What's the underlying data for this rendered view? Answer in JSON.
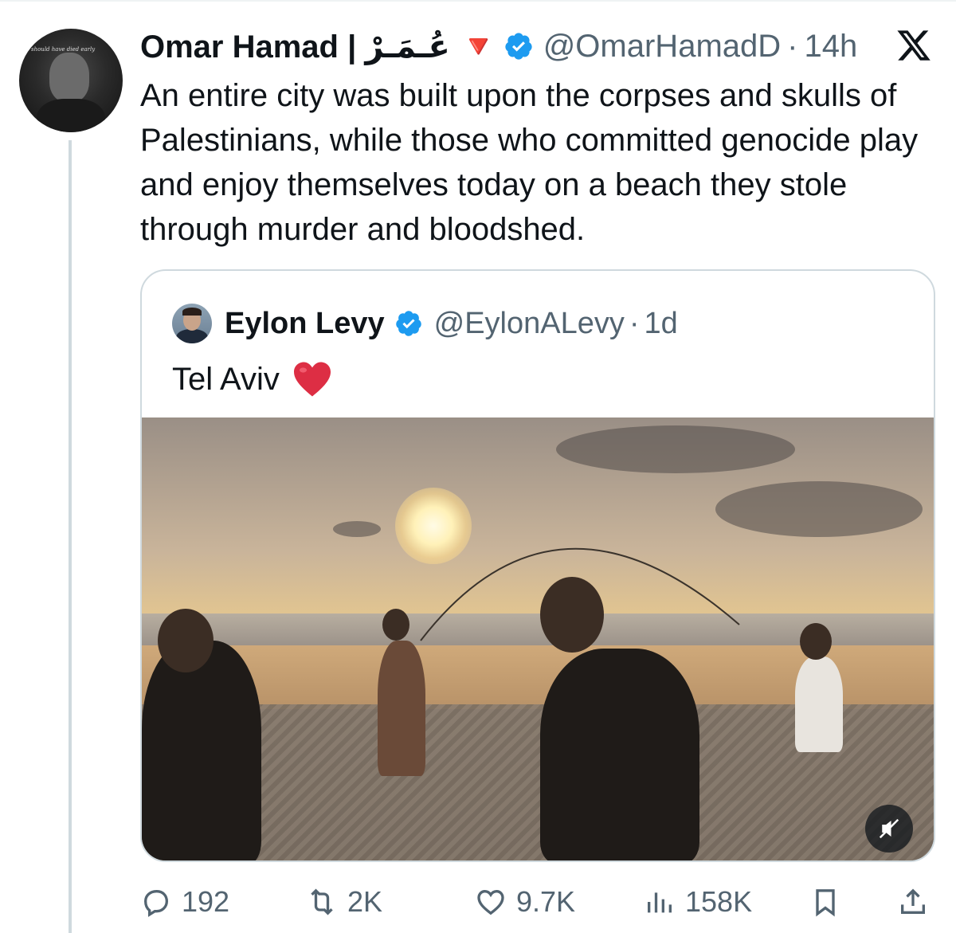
{
  "tweet": {
    "author_name": "Omar Hamad | عُـمَـرْ 🔻",
    "handle": "@OmarHamadD",
    "separator": "·",
    "time": "14h",
    "avatar_caption": "I should have died early",
    "text": "An entire city was built upon the corpses and skulls of Palestinians, while those who committed genocide play and enjoy themselves today on a beach they stole through murder and bloodshed."
  },
  "quote": {
    "author_name": "Eylon Levy",
    "handle": "@EylonALevy",
    "separator": "·",
    "time": "1d",
    "text": "Tel Aviv"
  },
  "actions": {
    "replies": "192",
    "reposts": "2K",
    "likes": "9.7K",
    "views": "158K"
  },
  "icons": {
    "brand": "x-logo-icon",
    "verified": "verified-badge-icon",
    "emoji": "red-heart-emoji",
    "mute": "speaker-muted-icon",
    "reply": "reply-bubble-icon",
    "repost": "repost-icon",
    "like": "heart-icon",
    "views": "bar-chart-icon",
    "bookmark": "bookmark-icon",
    "share": "share-upload-icon"
  },
  "colors": {
    "text": "#0f1419",
    "secondary": "#536471",
    "verified": "#1d9bf0",
    "border": "#cfd9de",
    "heart": "#e0245e"
  }
}
